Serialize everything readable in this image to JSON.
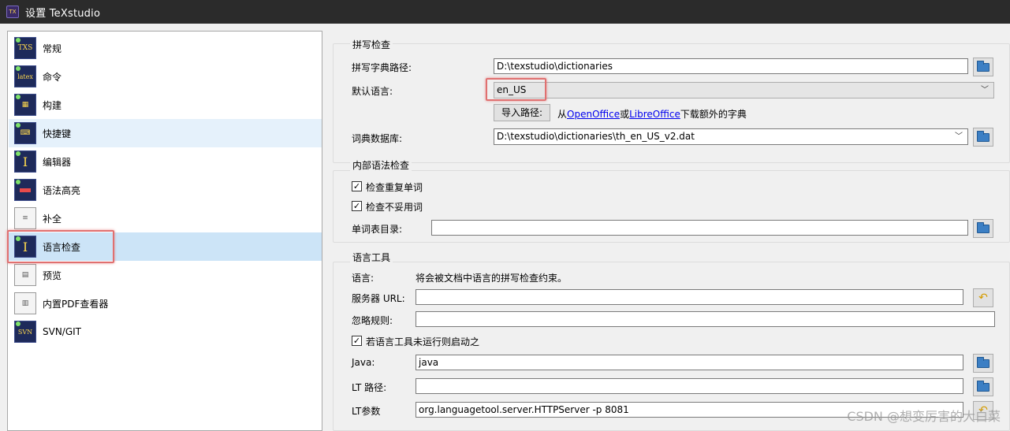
{
  "window": {
    "title": "设置 TeXstudio"
  },
  "nav": {
    "items": [
      {
        "label": "常规",
        "icon": "txs-logo-icon",
        "icon_text": "TXS"
      },
      {
        "label": "命令",
        "icon": "latex-command-icon",
        "icon_text": "latex"
      },
      {
        "label": "构建",
        "icon": "build-icon",
        "icon_text": ""
      },
      {
        "label": "快捷键",
        "icon": "keyboard-icon",
        "icon_text": ""
      },
      {
        "label": "编辑器",
        "icon": "text-cursor-icon",
        "icon_text": "I"
      },
      {
        "label": "语法高亮",
        "icon": "syntax-highlight-icon",
        "icon_text": ""
      },
      {
        "label": "补全",
        "icon": "completion-list-icon",
        "icon_text": ""
      },
      {
        "label": "语言检查",
        "icon": "language-check-icon",
        "icon_text": "I"
      },
      {
        "label": "预览",
        "icon": "preview-page-icon",
        "icon_text": ""
      },
      {
        "label": "内置PDF查看器",
        "icon": "pdf-viewer-icon",
        "icon_text": ""
      },
      {
        "label": "SVN/GIT",
        "icon": "svn-git-icon",
        "icon_text": "SVN"
      }
    ],
    "selected": "语言检查"
  },
  "spell": {
    "group_title": "拼写检查",
    "dict_path_label": "拼写字典路径:",
    "dict_path_value": "D:\\texstudio\\dictionaries",
    "default_lang_label": "默认语言:",
    "default_lang_value": "en_US",
    "import_button": "导入路径:",
    "import_text_prefix": "从",
    "openoffice_link": "OpenOffice",
    "or_text": "或",
    "libreoffice_link": "LibreOffice",
    "import_text_suffix": "下载额外的字典",
    "thesaurus_label": "词典数据库:",
    "thesaurus_value": "D:\\texstudio\\dictionaries\\th_en_US_v2.dat"
  },
  "grammar": {
    "group_title": "内部语法检查",
    "check_repeated_label": "检查重复单词",
    "check_repeated": true,
    "check_bad_words_label": "检查不妥用词",
    "check_bad_words": true,
    "wordlist_dir_label": "单词表目录:",
    "wordlist_dir_value": ""
  },
  "langtool": {
    "group_title": "语言工具",
    "language_label": "语言:",
    "language_note": "将会被文档中语言的拼写检查约束。",
    "server_url_label": "服务器 URL:",
    "server_url_value": "",
    "ignore_rules_label": "忽略规则:",
    "ignore_rules_value": "",
    "autostart_label": "若语言工具未运行则启动之",
    "autostart": true,
    "java_label": "Java:",
    "java_value": "java",
    "lt_path_label": "LT 路径:",
    "lt_path_value": "",
    "lt_args_label": "LT参数",
    "lt_args_value": "org.languagetool.server.HTTPServer -p 8081"
  },
  "watermark": "CSDN @想变厉害的大白菜"
}
